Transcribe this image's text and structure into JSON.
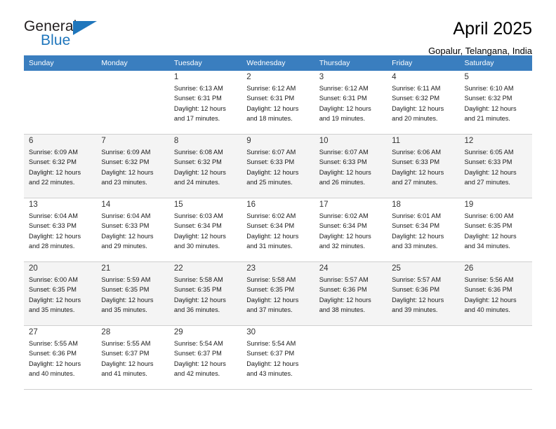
{
  "brand": {
    "name_top": "General",
    "name_bottom": "Blue",
    "accent_color": "#1f76bc",
    "triangle_icon": "triangle-logo-icon"
  },
  "header": {
    "title": "April 2025",
    "subtitle": "Gopalur, Telangana, India"
  },
  "calendar": {
    "header_bg": "#3a7ebf",
    "weekdays": [
      "Sunday",
      "Monday",
      "Tuesday",
      "Wednesday",
      "Thursday",
      "Friday",
      "Saturday"
    ],
    "labels": {
      "sunrise": "Sunrise:",
      "sunset": "Sunset:",
      "daylight": "Daylight:"
    },
    "weeks": [
      [
        {
          "day": ""
        },
        {
          "day": ""
        },
        {
          "day": "1",
          "sunrise": "Sunrise: 6:13 AM",
          "sunset": "Sunset: 6:31 PM",
          "daylight1": "Daylight: 12 hours",
          "daylight2": "and 17 minutes."
        },
        {
          "day": "2",
          "sunrise": "Sunrise: 6:12 AM",
          "sunset": "Sunset: 6:31 PM",
          "daylight1": "Daylight: 12 hours",
          "daylight2": "and 18 minutes."
        },
        {
          "day": "3",
          "sunrise": "Sunrise: 6:12 AM",
          "sunset": "Sunset: 6:31 PM",
          "daylight1": "Daylight: 12 hours",
          "daylight2": "and 19 minutes."
        },
        {
          "day": "4",
          "sunrise": "Sunrise: 6:11 AM",
          "sunset": "Sunset: 6:32 PM",
          "daylight1": "Daylight: 12 hours",
          "daylight2": "and 20 minutes."
        },
        {
          "day": "5",
          "sunrise": "Sunrise: 6:10 AM",
          "sunset": "Sunset: 6:32 PM",
          "daylight1": "Daylight: 12 hours",
          "daylight2": "and 21 minutes."
        }
      ],
      [
        {
          "day": "6",
          "sunrise": "Sunrise: 6:09 AM",
          "sunset": "Sunset: 6:32 PM",
          "daylight1": "Daylight: 12 hours",
          "daylight2": "and 22 minutes."
        },
        {
          "day": "7",
          "sunrise": "Sunrise: 6:09 AM",
          "sunset": "Sunset: 6:32 PM",
          "daylight1": "Daylight: 12 hours",
          "daylight2": "and 23 minutes."
        },
        {
          "day": "8",
          "sunrise": "Sunrise: 6:08 AM",
          "sunset": "Sunset: 6:32 PM",
          "daylight1": "Daylight: 12 hours",
          "daylight2": "and 24 minutes."
        },
        {
          "day": "9",
          "sunrise": "Sunrise: 6:07 AM",
          "sunset": "Sunset: 6:33 PM",
          "daylight1": "Daylight: 12 hours",
          "daylight2": "and 25 minutes."
        },
        {
          "day": "10",
          "sunrise": "Sunrise: 6:07 AM",
          "sunset": "Sunset: 6:33 PM",
          "daylight1": "Daylight: 12 hours",
          "daylight2": "and 26 minutes."
        },
        {
          "day": "11",
          "sunrise": "Sunrise: 6:06 AM",
          "sunset": "Sunset: 6:33 PM",
          "daylight1": "Daylight: 12 hours",
          "daylight2": "and 27 minutes."
        },
        {
          "day": "12",
          "sunrise": "Sunrise: 6:05 AM",
          "sunset": "Sunset: 6:33 PM",
          "daylight1": "Daylight: 12 hours",
          "daylight2": "and 27 minutes."
        }
      ],
      [
        {
          "day": "13",
          "sunrise": "Sunrise: 6:04 AM",
          "sunset": "Sunset: 6:33 PM",
          "daylight1": "Daylight: 12 hours",
          "daylight2": "and 28 minutes."
        },
        {
          "day": "14",
          "sunrise": "Sunrise: 6:04 AM",
          "sunset": "Sunset: 6:33 PM",
          "daylight1": "Daylight: 12 hours",
          "daylight2": "and 29 minutes."
        },
        {
          "day": "15",
          "sunrise": "Sunrise: 6:03 AM",
          "sunset": "Sunset: 6:34 PM",
          "daylight1": "Daylight: 12 hours",
          "daylight2": "and 30 minutes."
        },
        {
          "day": "16",
          "sunrise": "Sunrise: 6:02 AM",
          "sunset": "Sunset: 6:34 PM",
          "daylight1": "Daylight: 12 hours",
          "daylight2": "and 31 minutes."
        },
        {
          "day": "17",
          "sunrise": "Sunrise: 6:02 AM",
          "sunset": "Sunset: 6:34 PM",
          "daylight1": "Daylight: 12 hours",
          "daylight2": "and 32 minutes."
        },
        {
          "day": "18",
          "sunrise": "Sunrise: 6:01 AM",
          "sunset": "Sunset: 6:34 PM",
          "daylight1": "Daylight: 12 hours",
          "daylight2": "and 33 minutes."
        },
        {
          "day": "19",
          "sunrise": "Sunrise: 6:00 AM",
          "sunset": "Sunset: 6:35 PM",
          "daylight1": "Daylight: 12 hours",
          "daylight2": "and 34 minutes."
        }
      ],
      [
        {
          "day": "20",
          "sunrise": "Sunrise: 6:00 AM",
          "sunset": "Sunset: 6:35 PM",
          "daylight1": "Daylight: 12 hours",
          "daylight2": "and 35 minutes."
        },
        {
          "day": "21",
          "sunrise": "Sunrise: 5:59 AM",
          "sunset": "Sunset: 6:35 PM",
          "daylight1": "Daylight: 12 hours",
          "daylight2": "and 35 minutes."
        },
        {
          "day": "22",
          "sunrise": "Sunrise: 5:58 AM",
          "sunset": "Sunset: 6:35 PM",
          "daylight1": "Daylight: 12 hours",
          "daylight2": "and 36 minutes."
        },
        {
          "day": "23",
          "sunrise": "Sunrise: 5:58 AM",
          "sunset": "Sunset: 6:35 PM",
          "daylight1": "Daylight: 12 hours",
          "daylight2": "and 37 minutes."
        },
        {
          "day": "24",
          "sunrise": "Sunrise: 5:57 AM",
          "sunset": "Sunset: 6:36 PM",
          "daylight1": "Daylight: 12 hours",
          "daylight2": "and 38 minutes."
        },
        {
          "day": "25",
          "sunrise": "Sunrise: 5:57 AM",
          "sunset": "Sunset: 6:36 PM",
          "daylight1": "Daylight: 12 hours",
          "daylight2": "and 39 minutes."
        },
        {
          "day": "26",
          "sunrise": "Sunrise: 5:56 AM",
          "sunset": "Sunset: 6:36 PM",
          "daylight1": "Daylight: 12 hours",
          "daylight2": "and 40 minutes."
        }
      ],
      [
        {
          "day": "27",
          "sunrise": "Sunrise: 5:55 AM",
          "sunset": "Sunset: 6:36 PM",
          "daylight1": "Daylight: 12 hours",
          "daylight2": "and 40 minutes."
        },
        {
          "day": "28",
          "sunrise": "Sunrise: 5:55 AM",
          "sunset": "Sunset: 6:37 PM",
          "daylight1": "Daylight: 12 hours",
          "daylight2": "and 41 minutes."
        },
        {
          "day": "29",
          "sunrise": "Sunrise: 5:54 AM",
          "sunset": "Sunset: 6:37 PM",
          "daylight1": "Daylight: 12 hours",
          "daylight2": "and 42 minutes."
        },
        {
          "day": "30",
          "sunrise": "Sunrise: 5:54 AM",
          "sunset": "Sunset: 6:37 PM",
          "daylight1": "Daylight: 12 hours",
          "daylight2": "and 43 minutes."
        },
        {
          "day": ""
        },
        {
          "day": ""
        },
        {
          "day": ""
        }
      ]
    ]
  }
}
